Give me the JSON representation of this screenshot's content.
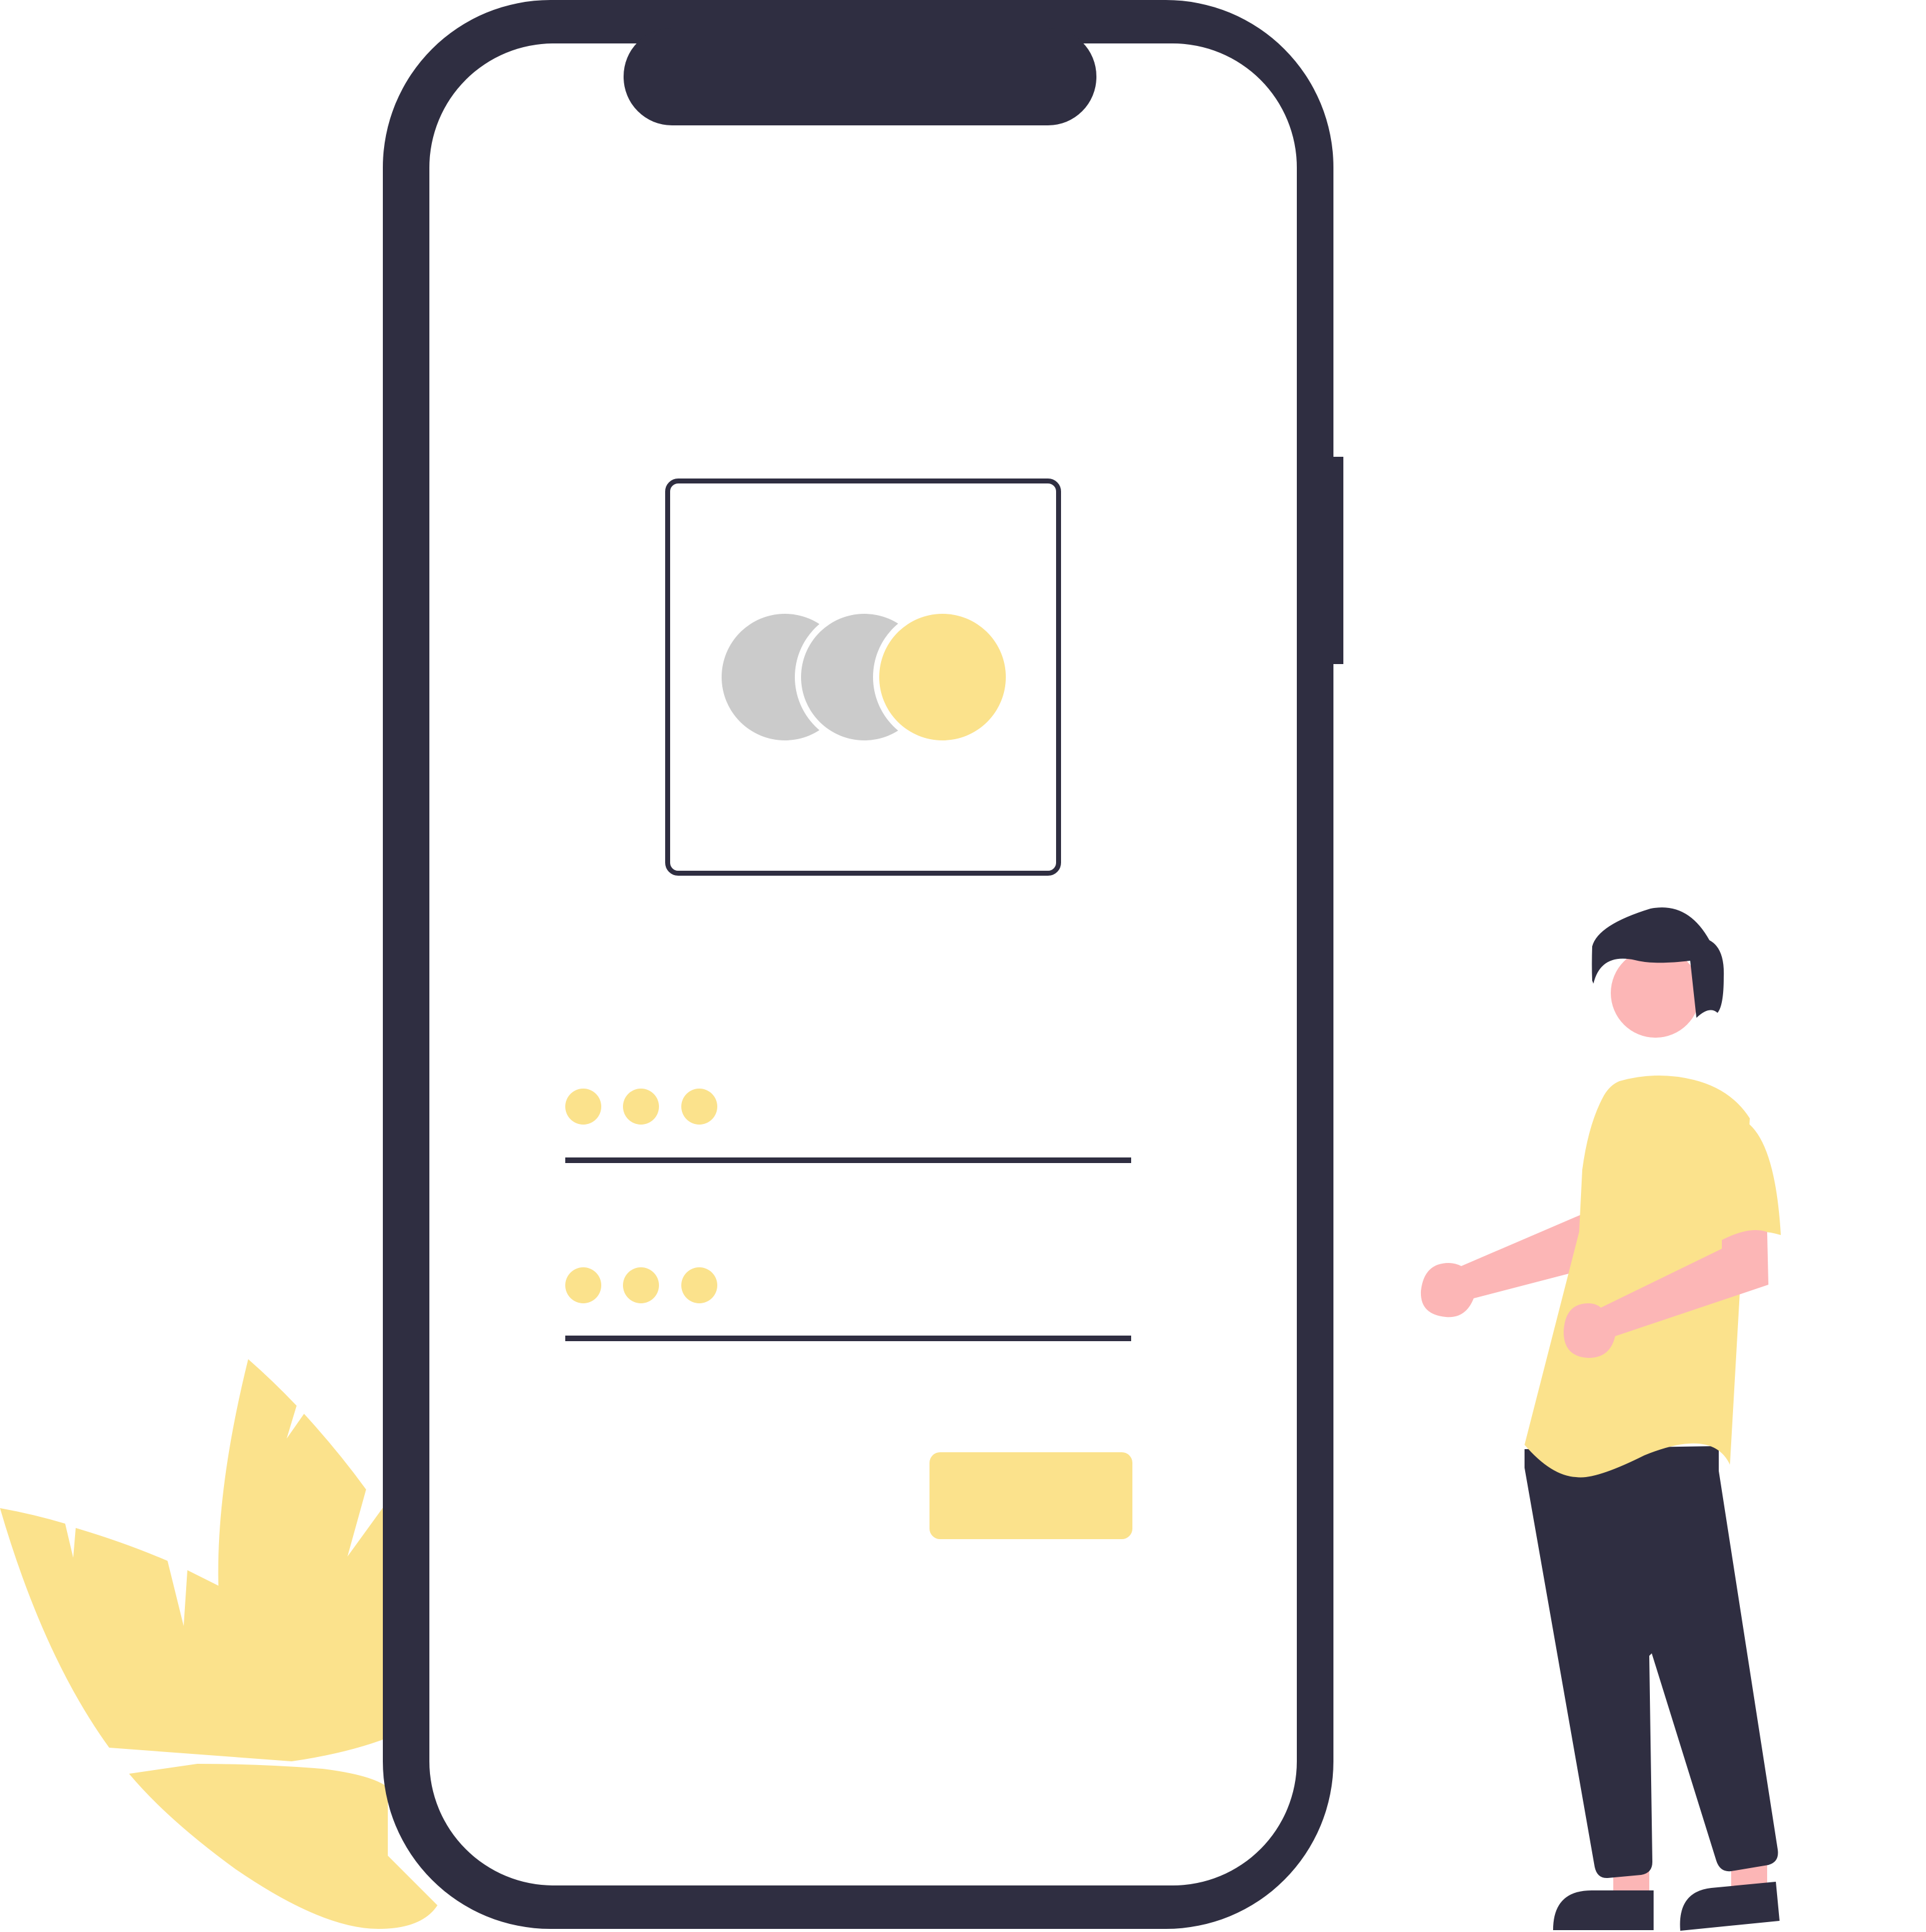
{
  "illustration": {
    "subject": "mobile-login-screen",
    "colors": {
      "dark": "#2f2e41",
      "accent": "#fbe28c",
      "gray": "#cbcbcb",
      "skin": "#fcb6b6",
      "white": "#ffffff"
    },
    "phone": {
      "logo": {
        "icon": "three-circles-logo-icon"
      },
      "username_field": {
        "masked_chars": 3,
        "icon": "password-dots-icon"
      },
      "password_field": {
        "masked_chars": 3,
        "icon": "password-dots-icon"
      },
      "submit_button": {
        "label": ""
      }
    }
  }
}
